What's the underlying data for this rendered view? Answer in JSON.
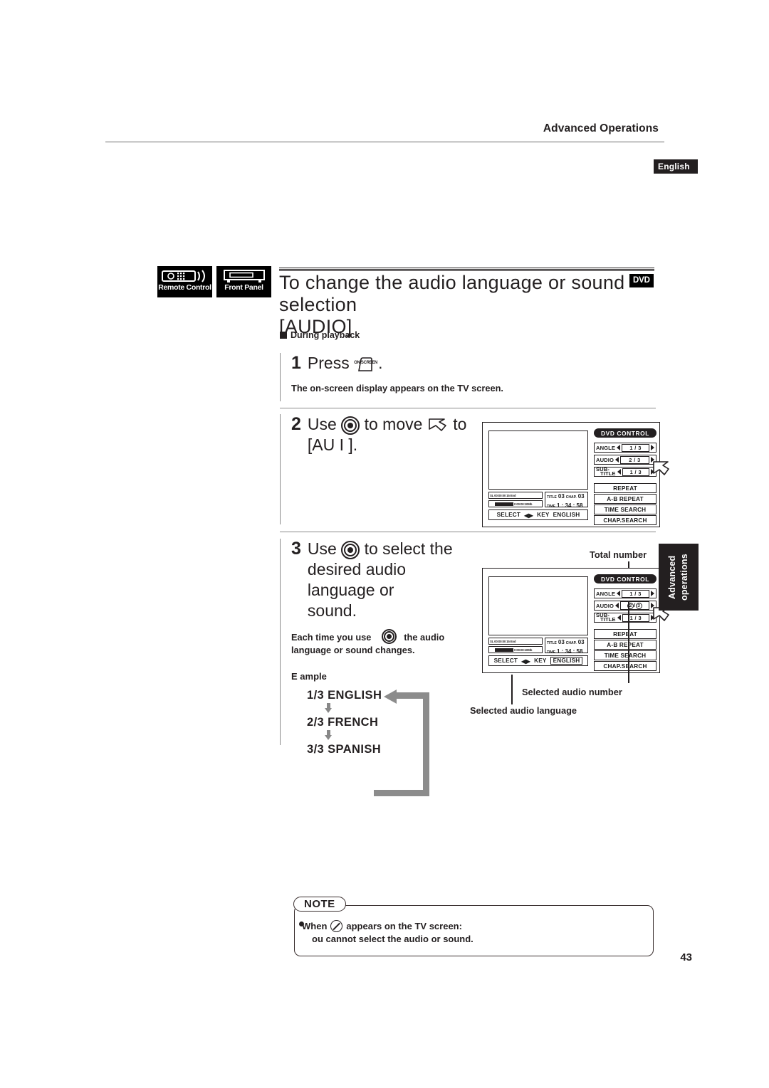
{
  "header": {
    "section_title": "Advanced Operations",
    "language_tab": "English"
  },
  "device_badges": [
    {
      "icon": "remote-control-icon",
      "label": "Remote Control"
    },
    {
      "icon": "front-panel-icon",
      "label": "Front Panel"
    }
  ],
  "title": {
    "line1": "To change the audio language or sound selection",
    "line2": "[AUDIO]",
    "media_badge": "DVD"
  },
  "section_marker": "During playback",
  "steps": [
    {
      "number": "1",
      "text_before": "Press",
      "icon": "on-screen-key-icon",
      "icon_caption": "ON SCREEN",
      "text_after": ".",
      "subtext": "The on-screen display appears on the TV screen."
    },
    {
      "number": "2",
      "text_a": "Use",
      "icon_a": "joystick-icon",
      "text_b": "to move",
      "icon_b": "cursor-arrow-icon",
      "text_c": "to",
      "text_d": "[AU  I  ]."
    },
    {
      "number": "3",
      "text_a": "Use",
      "icon_a": "joystick-icon",
      "text_b": "to select the",
      "line2": "desired audio language or",
      "line3": "sound.",
      "note_a": "Each time you use",
      "note_icon": "joystick-icon",
      "note_b": "the audio",
      "note_c": "language or sound changes."
    }
  ],
  "example": {
    "label": "E  ample",
    "cycle": [
      "1/3 ENGLISH",
      "2/3 FRENCH",
      "3/3 SPANISH"
    ],
    "loop": "loop-back-arrow"
  },
  "osd_panels": [
    {
      "id": "panel-step2",
      "header": "DVD CONTROL",
      "selectors": [
        {
          "name": "ANGLE",
          "value": "1 / 3",
          "highlight": false
        },
        {
          "name": "AUDIO",
          "value": "2 / 3",
          "highlight": false
        },
        {
          "name": "SUB-",
          "name2": "TITLE",
          "value": "1 / 3",
          "highlight": false
        }
      ],
      "functions": [
        "REPEAT",
        "A-B REPEAT",
        "TIME SEARCH",
        "CHAP.SEARCH"
      ],
      "status": {
        "bar_top": "SL 00:00:00   15 End",
        "bar_bottom": "0        00:00:10Mb",
        "title_label": "TITLE",
        "title_value": "03",
        "chapter_label": "CHAP.",
        "chapter_value": "03",
        "time_label": "TIME",
        "time_value": "1 : 34 : 58",
        "select_text": "SELECT",
        "key_arrows": "◀▶",
        "key_text": "KEY",
        "language": "ENGLISH",
        "language_highlight": false
      }
    },
    {
      "id": "panel-step3",
      "header": "DVD CONTROL",
      "selectors": [
        {
          "name": "ANGLE",
          "value": "1 / 3",
          "highlight": false
        },
        {
          "name": "AUDIO",
          "value_a": "2",
          "value_sep": "/",
          "value_b": "3",
          "circled": true,
          "highlight": true
        },
        {
          "name": "SUB-",
          "name2": "TITLE",
          "value": "1 / 3",
          "highlight": false
        }
      ],
      "functions": [
        "REPEAT",
        "A-B REPEAT",
        "TIME SEARCH",
        "CHAP.SEARCH"
      ],
      "status": {
        "bar_top": "SL 00:00:00   15 End",
        "bar_bottom": "0        00:00:10Mb",
        "title_label": "TITLE",
        "title_value": "03",
        "chapter_label": "CHAP.",
        "chapter_value": "03",
        "time_label": "TIME",
        "time_value": "1 : 34 : 58",
        "select_text": "SELECT",
        "key_arrows": "◀▶",
        "key_text": "KEY",
        "language": "ENGLISH",
        "language_highlight": true
      }
    }
  ],
  "callouts": {
    "total_number": "Total number",
    "selected_audio_number": "Selected audio number",
    "selected_audio_language": "Selected audio language"
  },
  "side_tab": {
    "line1": "Advanced",
    "line2": "operations"
  },
  "note": {
    "tag": "NOTE",
    "line1_before": "When",
    "icon": "prohibited-icon",
    "line1_after": "appears on the TV screen:",
    "line2": "ou cannot select the audio or sound."
  },
  "page_number": "43"
}
